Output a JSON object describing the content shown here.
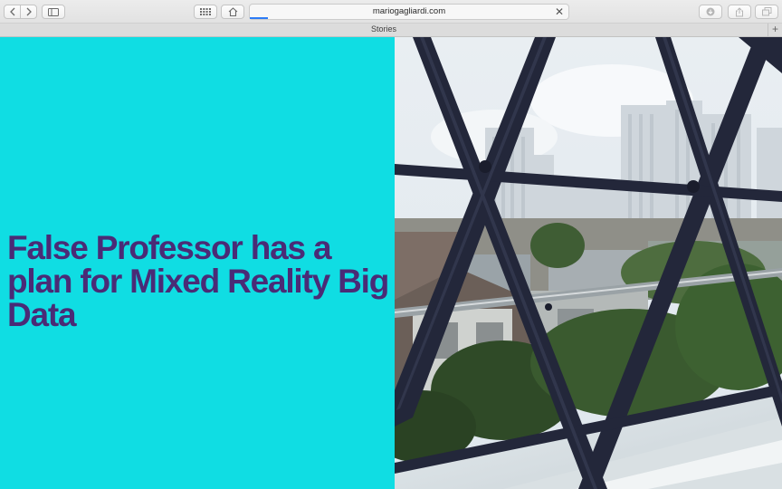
{
  "browser": {
    "url": "mariogagliardi.com",
    "tab_title": "Stories",
    "new_tab_symbol": "+",
    "clear_symbol": "✕",
    "icons": {
      "back": "chevron-left-icon",
      "forward": "chevron-right-icon",
      "sidebar": "sidebar-icon",
      "top_sites": "grid-icon",
      "home": "home-icon",
      "downloads": "download-icon",
      "share": "share-icon",
      "tabs": "tabs-overview-icon"
    }
  },
  "page": {
    "headline": "False Professor has a plan for Mixed Reality Big Data",
    "colors": {
      "background": "#10dde3",
      "headline": "#4a2b76"
    }
  }
}
